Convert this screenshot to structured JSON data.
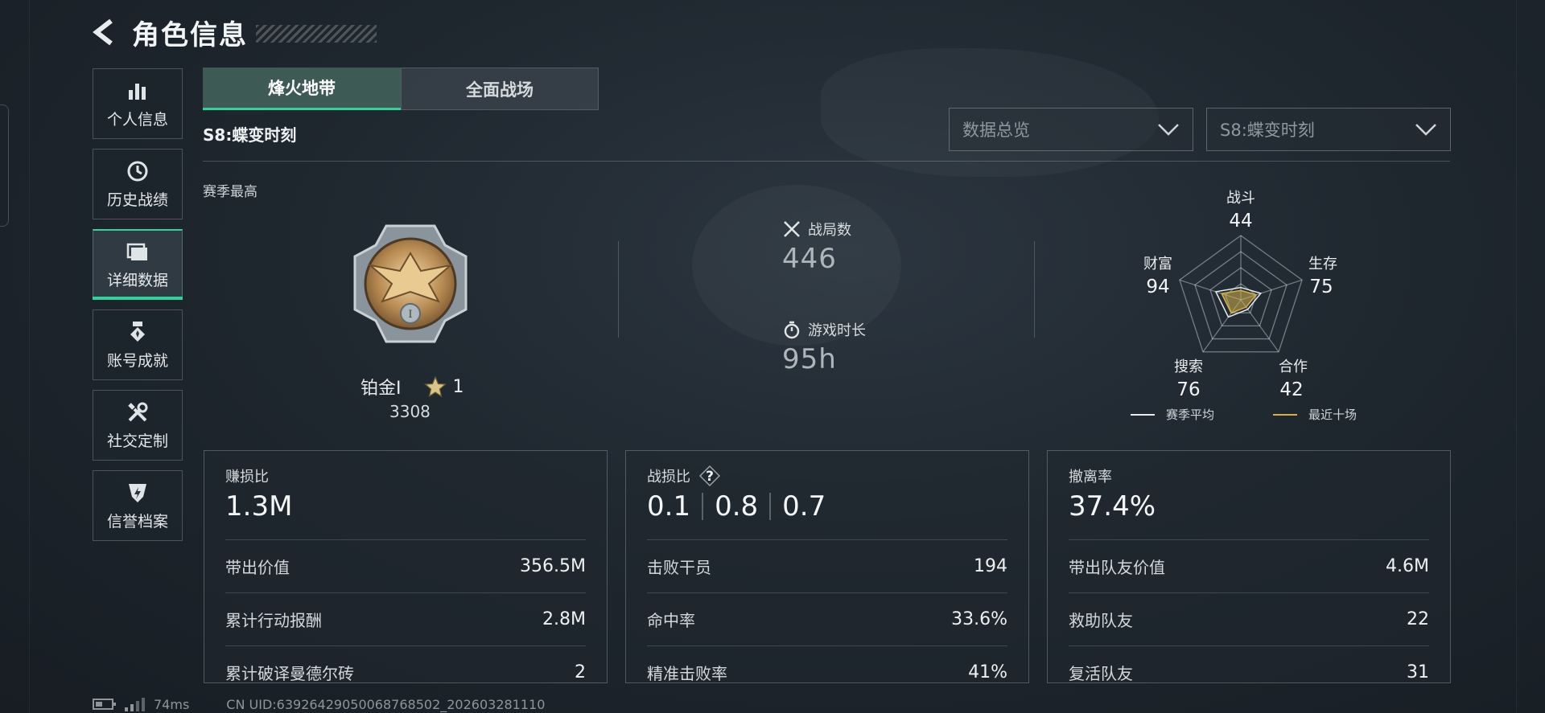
{
  "header": {
    "title": "角色信息"
  },
  "sidebar": {
    "items": [
      {
        "label": "个人信息",
        "icon": "bar-chart-icon"
      },
      {
        "label": "历史战绩",
        "icon": "history-icon"
      },
      {
        "label": "详细数据",
        "icon": "folder-icon",
        "active": true
      },
      {
        "label": "账号成就",
        "icon": "medal-icon"
      },
      {
        "label": "社交定制",
        "icon": "tools-icon"
      },
      {
        "label": "信誉档案",
        "icon": "shield-icon"
      }
    ]
  },
  "tabs": [
    {
      "label": "烽火地带",
      "active": true
    },
    {
      "label": "全面战场",
      "active": false
    }
  ],
  "season": {
    "label": "S8:蝶变时刻"
  },
  "filters": {
    "view": "数据总览",
    "season": "S8:蝶变时刻"
  },
  "best": {
    "section_label": "赛季最高",
    "rank_name": "铂金Ⅰ",
    "stars": "1",
    "score": "3308"
  },
  "stats": {
    "matches_label": "战局数",
    "matches_value": "446",
    "playtime_label": "游戏时长",
    "playtime_value": "95h"
  },
  "radar": {
    "axes": [
      {
        "label": "战斗",
        "value": "44"
      },
      {
        "label": "生存",
        "value": "75"
      },
      {
        "label": "合作",
        "value": "42"
      },
      {
        "label": "搜索",
        "value": "76"
      },
      {
        "label": "财富",
        "value": "94"
      }
    ],
    "series_values": [
      44,
      75,
      42,
      76,
      94
    ],
    "legend": {
      "season_avg": "赛季平均",
      "recent_ten": "最近十场"
    },
    "colors": {
      "season_avg": "#e8ecee",
      "recent_ten": "#d4b04a"
    }
  },
  "cards": {
    "profit": {
      "title": "赚损比",
      "value": "1.3M",
      "rows": [
        {
          "label": "带出价值",
          "value": "356.5M"
        },
        {
          "label": "累计行动报酬",
          "value": "2.8M"
        },
        {
          "label": "累计破译曼德尔砖",
          "value": "2"
        }
      ]
    },
    "combat": {
      "title": "战损比",
      "help": "?",
      "values": [
        "0.1",
        "0.8",
        "0.7"
      ],
      "rows": [
        {
          "label": "击败干员",
          "value": "194"
        },
        {
          "label": "命中率",
          "value": "33.6%"
        },
        {
          "label": "精准击败率",
          "value": "41%"
        }
      ]
    },
    "extract": {
      "title": "撤离率",
      "value": "37.4%",
      "rows": [
        {
          "label": "带出队友价值",
          "value": "4.6M"
        },
        {
          "label": "救助队友",
          "value": "22"
        },
        {
          "label": "复活队友",
          "value": "31"
        }
      ]
    }
  },
  "footer": {
    "ping": "74ms",
    "uid": "CN UID:6392642905006876850​2_202603281110"
  },
  "colors": {
    "accent": "#2fd39b",
    "background": "#1f272f"
  }
}
